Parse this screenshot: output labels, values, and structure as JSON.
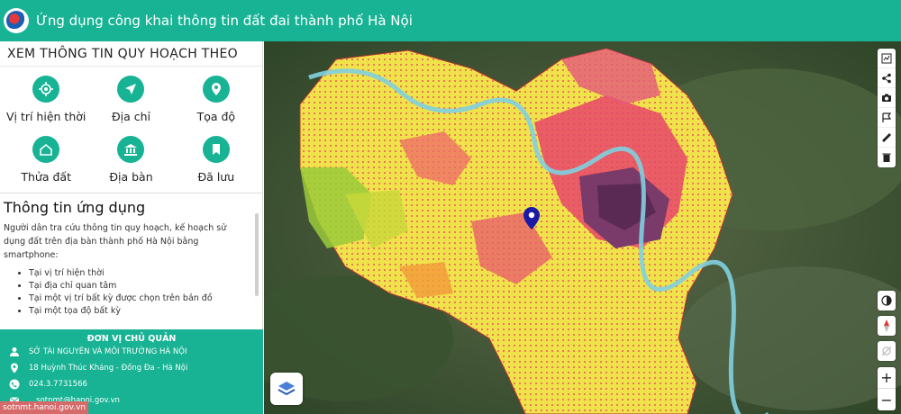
{
  "header": {
    "title": "Ứng dụng công khai thông tin đất đai thành phố Hà Nội"
  },
  "sidebar": {
    "section_title": "XEM THÔNG TIN QUY HOẠCH THEO",
    "options": [
      {
        "label": "Vị trí hiện thời",
        "icon": "crosshair-icon"
      },
      {
        "label": "Địa chỉ",
        "icon": "navigation-arrow-icon"
      },
      {
        "label": "Tọa độ",
        "icon": "map-pin-icon"
      },
      {
        "label": "Thửa đất",
        "icon": "home-icon"
      },
      {
        "label": "Địa bàn",
        "icon": "bank-building-icon"
      },
      {
        "label": "Đã lưu",
        "icon": "bookmark-icon"
      }
    ],
    "info": {
      "title": "Thông tin ứng dụng",
      "description": "Người dân tra cứu thông tin quy hoạch, kế hoạch sử dụng đất trên địa bàn thành phố Hà Nội bằng smartphone:",
      "items": [
        "Tại vị trí hiện thời",
        "Tại địa chỉ quan tâm",
        "Tại một vị trí bất kỳ được chọn trên bản đồ",
        "Tại một tọa độ bất kỳ"
      ]
    },
    "owner": {
      "title": "ĐƠN VỊ CHỦ QUẢN",
      "org": "SỞ TÀI NGUYÊN VÀ MÔI TRƯỜNG HÀ NỘI",
      "address": "18 Huỳnh Thúc Kháng - Đống Đa - Hà Nội",
      "phone": "024.3.7731566",
      "email": "...sotnmt@hanoi.gov.vn"
    },
    "source_tag": "sotnmt.hanoi.gov.vn"
  },
  "map": {
    "tools": [
      "chart-icon",
      "share-icon",
      "camera-icon",
      "flag-icon",
      "ruler-icon",
      "trash-icon"
    ],
    "controls": [
      "contrast-icon",
      "compass-icon",
      "location-off-icon"
    ],
    "zoom_in": "+",
    "zoom_out": "−"
  },
  "colors": {
    "accent": "#17b394",
    "pin": "#1a1aa6"
  }
}
